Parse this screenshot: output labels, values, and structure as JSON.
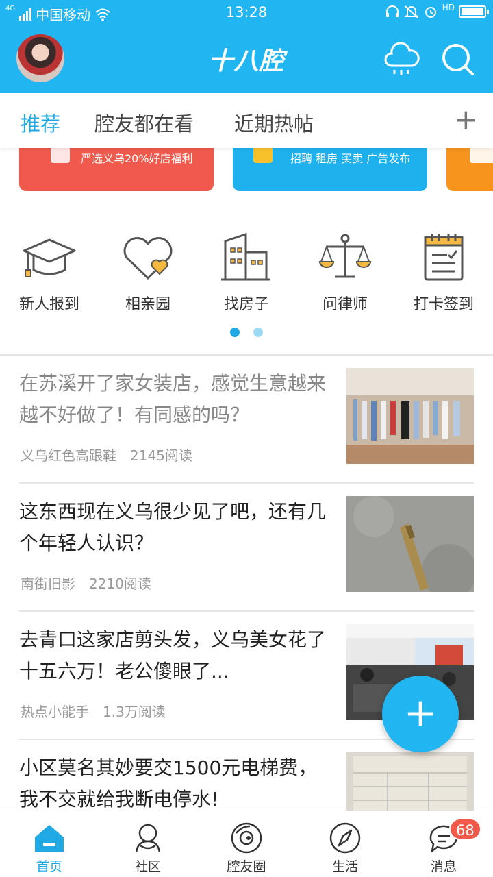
{
  "status_bar": {
    "network_type": "4G",
    "carrier": "中国移动",
    "time": "13:28",
    "icons": [
      "wifi-icon",
      "headphone-icon",
      "mute-icon",
      "alarm-icon",
      "hd-call-icon",
      "battery-icon"
    ],
    "hd_label": "HD"
  },
  "header": {
    "logo": "十八腔",
    "left_icon": "avatar",
    "right_icons": [
      "cloud-icon",
      "search-icon"
    ]
  },
  "tabs": {
    "items": [
      {
        "label": "推荐",
        "active": true
      },
      {
        "label": "腔友都在看",
        "active": false
      },
      {
        "label": "近期热帖",
        "active": false
      }
    ],
    "add_label": "+"
  },
  "banners": [
    {
      "text": "严选义乌20%好店福利",
      "color": "#ef5a4c"
    },
    {
      "text": "招聘 租房 买卖 广告发布",
      "color": "#1fb1ee"
    },
    {
      "text": "",
      "color": "#f7941d"
    }
  ],
  "quick_links": [
    {
      "label": "新人报到",
      "icon": "graduation-cap-icon"
    },
    {
      "label": "相亲园",
      "icon": "hearts-icon"
    },
    {
      "label": "找房子",
      "icon": "building-icon"
    },
    {
      "label": "问律师",
      "icon": "scales-icon"
    },
    {
      "label": "打卡签到",
      "icon": "calendar-checkin-icon"
    }
  ],
  "pager": {
    "pages": 2,
    "current": 1
  },
  "posts": [
    {
      "title": "在苏溪开了家女装店，感觉生意越来越不好做了！有同感的吗？",
      "author": "义乌红色高跟鞋",
      "reads": "2145阅读",
      "read": true
    },
    {
      "title": "这东西现在义乌很少见了吧，还有几个年轻人认识？",
      "author": "南街旧影",
      "reads": "2210阅读",
      "read": false
    },
    {
      "title": "去青口这家店剪头发，义乌美女花了十五六万！老公傻眼了...",
      "author": "热点小能手",
      "reads": "1.3万阅读",
      "read": false
    },
    {
      "title": "小区莫名其妙要交1500元电梯费，我不交就给我断电停水!",
      "author": "",
      "reads": "",
      "read": false
    }
  ],
  "fab_label": "+",
  "bottom_nav": [
    {
      "label": "首页",
      "icon": "home-icon",
      "active": true
    },
    {
      "label": "社区",
      "icon": "community-icon",
      "active": false
    },
    {
      "label": "腔友圈",
      "icon": "circle-icon",
      "active": false
    },
    {
      "label": "生活",
      "icon": "compass-icon",
      "active": false
    },
    {
      "label": "消息",
      "icon": "message-icon",
      "active": false,
      "badge": "68"
    }
  ],
  "colors": {
    "primary": "#21b6f2",
    "active_text": "#21a9e6",
    "badge": "#f15a4a"
  }
}
